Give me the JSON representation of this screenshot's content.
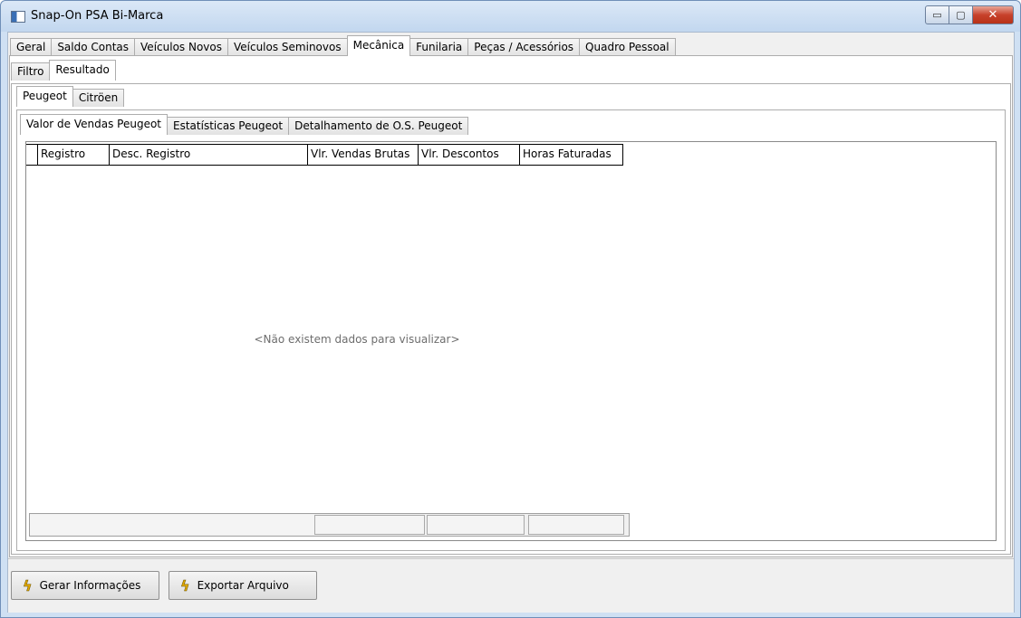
{
  "window": {
    "title": "Snap-On PSA Bi-Marca",
    "min_glyph": "▭",
    "max_glyph": "▢",
    "close_glyph": "✕"
  },
  "main_tabs": [
    {
      "label": "Geral"
    },
    {
      "label": "Saldo Contas"
    },
    {
      "label": "Veículos Novos"
    },
    {
      "label": "Veículos Seminovos"
    },
    {
      "label": "Mecânica",
      "active": true
    },
    {
      "label": "Funilaria"
    },
    {
      "label": "Peças / Acessórios"
    },
    {
      "label": "Quadro Pessoal"
    }
  ],
  "view_tabs": [
    {
      "label": "Filtro"
    },
    {
      "label": "Resultado",
      "active": true
    }
  ],
  "brand_tabs": [
    {
      "label": "Peugeot",
      "active": true
    },
    {
      "label": "Citröen"
    }
  ],
  "report_tabs": [
    {
      "label": "Valor de Vendas Peugeot",
      "active": true
    },
    {
      "label": "Estatísticas Peugeot"
    },
    {
      "label": "Detalhamento de O.S. Peugeot"
    }
  ],
  "grid": {
    "columns": [
      "Registro",
      "Desc. Registro",
      "Vlr. Vendas Brutas",
      "Vlr. Descontos",
      "Horas Faturadas"
    ],
    "empty_message": "<Não existem dados para visualizar>"
  },
  "actions": {
    "generate_label": "Gerar Informações",
    "export_label": "Exportar Arquivo",
    "icon": "lightning-icon"
  },
  "colors": {
    "bolt": "#e0a800",
    "close_button": "#c7412b"
  }
}
